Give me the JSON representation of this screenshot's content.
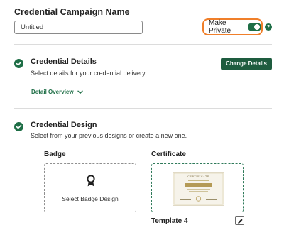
{
  "campaign": {
    "title": "Credential Campaign Name",
    "name_value": "Untitled",
    "make_private_label": "Make Private",
    "make_private_enabled": true,
    "help_icon_glyph": "?"
  },
  "details": {
    "title": "Credential Details",
    "description": "Select details for your credential delivery.",
    "change_button_label": "Change Details",
    "overview_link_label": "Detail Overview"
  },
  "design": {
    "title": "Credential Design",
    "description": "Select from your previous designs or create a new one.",
    "badge_label": "Badge",
    "badge_placeholder": "Select Badge Design",
    "certificate_label": "Certificate",
    "certificate_thumb_heading": "CERTIFICATE",
    "template_name": "Template 4"
  },
  "colors": {
    "accent_green": "#1e6e46",
    "button_green": "#1e5c3f",
    "highlight_orange": "#f07f2a"
  },
  "icons": {
    "help": "help-icon",
    "check": "check-circle-icon",
    "chevron": "chevron-down-icon",
    "badge": "award-icon",
    "edit": "pencil-icon"
  }
}
